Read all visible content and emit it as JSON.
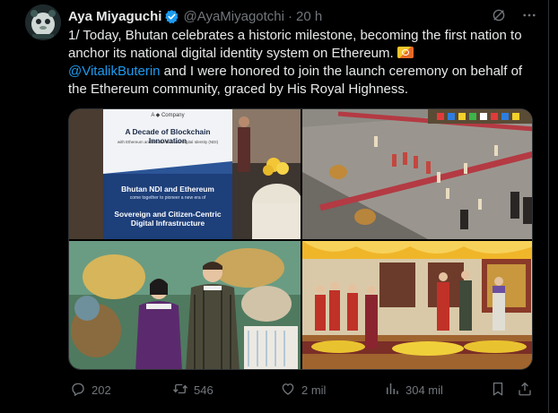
{
  "author": {
    "name": "Aya Miyaguchi",
    "handle": "@AyaMiyagotchi",
    "separator": "·",
    "time": "20 h",
    "verified_color": "#1d9bf0"
  },
  "tweet": {
    "line1": "1/ Today, Bhutan celebrates a historic milestone, becoming the first nation to anchor its national digital identity system on Ethereum.",
    "mention": "@VitalikButerin",
    "line2": " and I were honored to join the launch ceremony on behalf of the Ethereum community, graced by His Royal Highness.",
    "link_color": "#1d9bf0"
  },
  "images": {
    "banner_company": "A ◆ Company",
    "banner_title": "A Decade of Blockchain Innovation",
    "banner_subtitle": "with Ethereum and Bhutan National Digital Identity (NDI)",
    "banner_heading1": "Bhutan NDI and Ethereum",
    "banner_sub1": "come together to pioneer a new era of",
    "banner_heading2": "Sovereign and Citizen-Centric Digital Infrastructure"
  },
  "actions": {
    "replies": "202",
    "reposts": "546",
    "likes": "2 mil",
    "views": "304 mil"
  },
  "icons": {
    "verified": "verified-badge-icon",
    "grok": "grok-icon",
    "more": "more-icon",
    "reply": "reply-icon",
    "repost": "repost-icon",
    "like": "like-icon",
    "views": "views-icon",
    "bookmark": "bookmark-icon",
    "share": "share-icon"
  }
}
